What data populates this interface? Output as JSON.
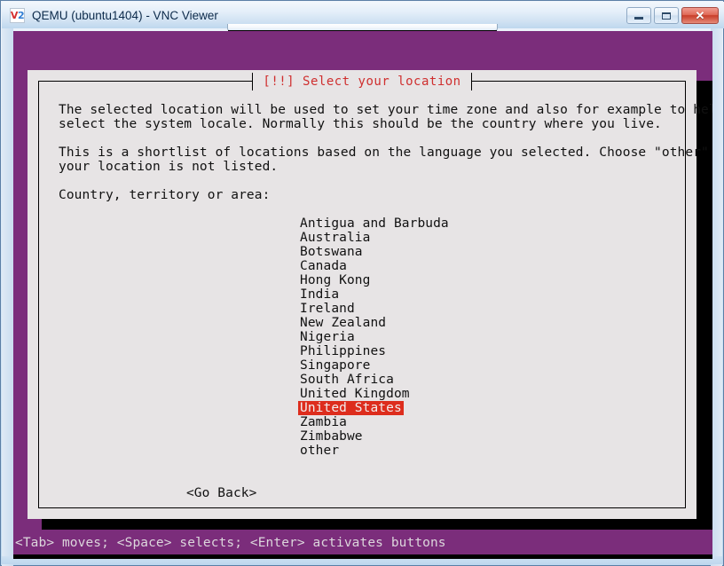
{
  "window": {
    "title": "QEMU (ubuntu1404) - VNC Viewer",
    "app_icon": "vnc-viewer-icon",
    "icon_letter_1": "V",
    "icon_letter_2": "2",
    "controls": {
      "minimize": "–",
      "maximize": "□",
      "close": "✕"
    }
  },
  "dialog": {
    "title": "[!!] Select your location",
    "title_color": "#cf2f2f",
    "paragraphs": [
      "The selected location will be used to set your time zone and also for example to help\nselect the system locale. Normally this should be the country where you live.",
      "This is a shortlist of locations based on the language you selected. Choose \"other\" if\nyour location is not listed."
    ],
    "list_label": "Country, territory or area:",
    "countries": [
      "Antigua and Barbuda",
      "Australia",
      "Botswana",
      "Canada",
      "Hong Kong",
      "India",
      "Ireland",
      "New Zealand",
      "Nigeria",
      "Philippines",
      "Singapore",
      "South Africa",
      "United Kingdom",
      "United States",
      "Zambia",
      "Zimbabwe",
      "other"
    ],
    "selected_country": "United States",
    "selected_index": 13,
    "highlight_color": "#dd2d1d",
    "go_back_label": "<Go Back>"
  },
  "status_bar": {
    "text": "<Tab> moves; <Space> selects; <Enter> activates buttons"
  },
  "colors": {
    "desktop_purple": "#7b2d7b",
    "dialog_background": "#e7e4e5",
    "text": "#111111"
  }
}
